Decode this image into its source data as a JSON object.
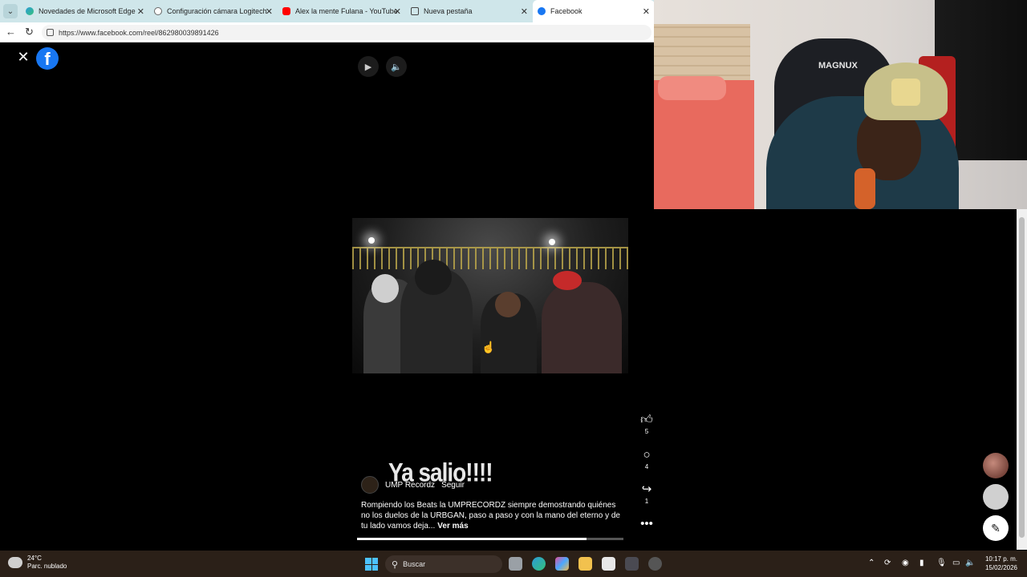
{
  "browser": {
    "tabs": [
      {
        "label": "Novedades de Microsoft Edge",
        "icon": "edge-icon",
        "active": false
      },
      {
        "label": "Configuración cámara Logitech",
        "icon": "globe-icon",
        "active": false
      },
      {
        "label": "Alex la mente Fulana - YouTube",
        "icon": "youtube-icon",
        "active": false
      },
      {
        "label": "Nueva pestaña",
        "icon": "new-tab-icon",
        "active": false
      },
      {
        "label": "Facebook",
        "icon": "facebook-icon",
        "active": true
      }
    ],
    "url": "https://www.facebook.com/reel/862980039891426"
  },
  "reel": {
    "overlay_text": "Ya salio!!!!",
    "author": "UMP Recordz",
    "follow_label": "Seguir",
    "caption": "Rompiendo los Beats la UMPRECORDZ siempre demostrando quiénes no los duelos de la URBGAN, paso a paso y con la mano del eterno y de tu lado vamos deja...",
    "see_more": "Ver más",
    "likes": "5",
    "comments": "4",
    "shares": "1",
    "progress": 0.86
  },
  "webcam": {
    "chair_brand": "MAGNUX"
  },
  "taskbar": {
    "temperature": "24°C",
    "weather": "Parc. nublado",
    "search_placeholder": "Buscar",
    "time": "10:17 p. m.",
    "date": "15/02/2026"
  },
  "colors": {
    "facebook_blue": "#1877f2",
    "tabbar_bg": "#cfe6ea",
    "taskbar_bg": "#2b2018"
  }
}
